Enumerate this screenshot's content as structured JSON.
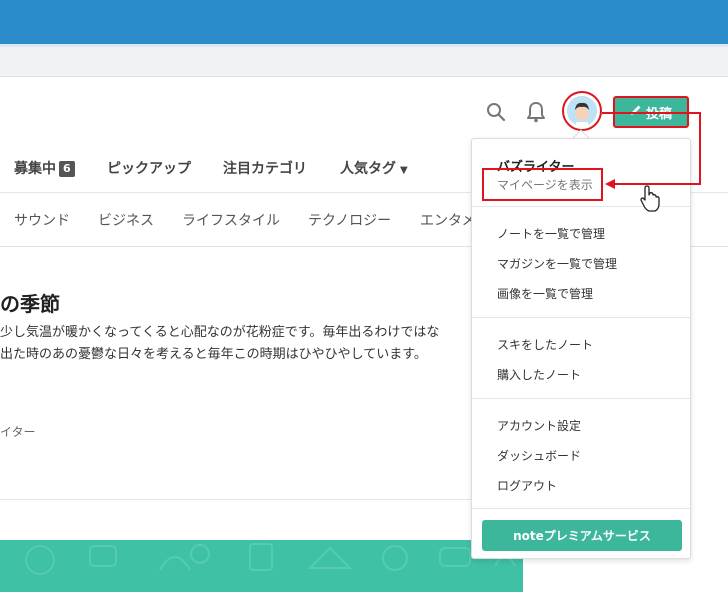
{
  "header": {
    "post_button_label": "投稿"
  },
  "nav_primary": [
    {
      "label": "募集中",
      "badge": "6"
    },
    {
      "label": "ピックアップ"
    },
    {
      "label": "注目カテゴリ"
    },
    {
      "label": "人気タグ"
    }
  ],
  "nav_categories": [
    "サウンド",
    "ビジネス",
    "ライフスタイル",
    "テクノロジー",
    "エンタメ"
  ],
  "article": {
    "title": "の季節",
    "body_line1": "少し気温が暖かくなってくると心配なのが花粉症です。毎年出るわけではな",
    "body_line2": "出た時のあの憂鬱な日々を考えると毎年この時期はひやひやしています。",
    "author": "イター"
  },
  "dropdown": {
    "username": "バズライター",
    "mypage_label": "マイページを表示",
    "group1": [
      "ノートを一覧で管理",
      "マガジンを一覧で管理",
      "画像を一覧で管理"
    ],
    "group2": [
      "スキをしたノート",
      "購入したノート"
    ],
    "group3": [
      "アカウント設定",
      "ダッシュボード",
      "ログアウト"
    ],
    "premium_label": "noteプレミアムサービス"
  },
  "colors": {
    "accent_green": "#3cb79b",
    "annotation_red": "#e0141e",
    "browser_blue": "#2b8ccb"
  }
}
